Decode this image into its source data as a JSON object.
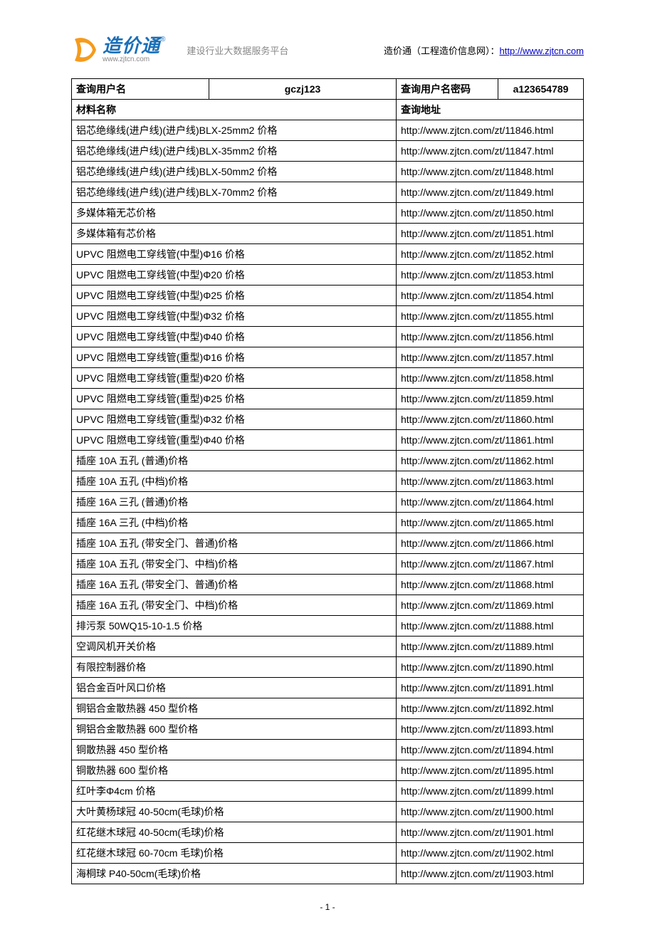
{
  "header": {
    "logo_main": "造价通",
    "logo_sub": "www.zjtcn.com",
    "tagline": "建设行业大数据服务平台",
    "right_prefix": "造价通（工程造价信息网）：",
    "right_link": "http://www.zjtcn.com"
  },
  "login_row": {
    "user_label": "查询用户名",
    "user_value": "gczj123",
    "pw_label": "查询用户名密码",
    "pw_value": "a123654789"
  },
  "table_header": {
    "name_label": "材料名称",
    "url_label": "查询地址"
  },
  "rows": [
    {
      "name": "铝芯绝缘线(进户线)(进户线)BLX-25mm2 价格",
      "url": "http://www.zjtcn.com/zt/11846.html"
    },
    {
      "name": "铝芯绝缘线(进户线)(进户线)BLX-35mm2 价格",
      "url": "http://www.zjtcn.com/zt/11847.html"
    },
    {
      "name": "铝芯绝缘线(进户线)(进户线)BLX-50mm2 价格",
      "url": "http://www.zjtcn.com/zt/11848.html"
    },
    {
      "name": "铝芯绝缘线(进户线)(进户线)BLX-70mm2 价格",
      "url": "http://www.zjtcn.com/zt/11849.html"
    },
    {
      "name": "多媒体箱无芯价格",
      "url": "http://www.zjtcn.com/zt/11850.html"
    },
    {
      "name": "多媒体箱有芯价格",
      "url": "http://www.zjtcn.com/zt/11851.html"
    },
    {
      "name": "UPVC 阻燃电工穿线管(中型)Φ16 价格",
      "url": "http://www.zjtcn.com/zt/11852.html"
    },
    {
      "name": "UPVC 阻燃电工穿线管(中型)Φ20 价格",
      "url": "http://www.zjtcn.com/zt/11853.html"
    },
    {
      "name": "UPVC 阻燃电工穿线管(中型)Φ25 价格",
      "url": "http://www.zjtcn.com/zt/11854.html"
    },
    {
      "name": "UPVC 阻燃电工穿线管(中型)Φ32 价格",
      "url": "http://www.zjtcn.com/zt/11855.html"
    },
    {
      "name": "UPVC 阻燃电工穿线管(中型)Φ40 价格",
      "url": "http://www.zjtcn.com/zt/11856.html"
    },
    {
      "name": "UPVC 阻燃电工穿线管(重型)Φ16 价格",
      "url": "http://www.zjtcn.com/zt/11857.html"
    },
    {
      "name": "UPVC 阻燃电工穿线管(重型)Φ20 价格",
      "url": "http://www.zjtcn.com/zt/11858.html"
    },
    {
      "name": "UPVC 阻燃电工穿线管(重型)Φ25 价格",
      "url": "http://www.zjtcn.com/zt/11859.html"
    },
    {
      "name": "UPVC 阻燃电工穿线管(重型)Φ32 价格",
      "url": "http://www.zjtcn.com/zt/11860.html"
    },
    {
      "name": "UPVC 阻燃电工穿线管(重型)Φ40 价格",
      "url": "http://www.zjtcn.com/zt/11861.html"
    },
    {
      "name": "插座 10A 五孔 (普通)价格",
      "url": "http://www.zjtcn.com/zt/11862.html"
    },
    {
      "name": "插座 10A 五孔 (中档)价格",
      "url": "http://www.zjtcn.com/zt/11863.html"
    },
    {
      "name": "插座 16A 三孔 (普通)价格",
      "url": "http://www.zjtcn.com/zt/11864.html"
    },
    {
      "name": "插座 16A 三孔 (中档)价格",
      "url": "http://www.zjtcn.com/zt/11865.html"
    },
    {
      "name": "插座 10A 五孔 (带安全门、普通)价格",
      "url": "http://www.zjtcn.com/zt/11866.html"
    },
    {
      "name": "插座 10A 五孔 (带安全门、中档)价格",
      "url": "http://www.zjtcn.com/zt/11867.html"
    },
    {
      "name": "插座 16A 五孔 (带安全门、普通)价格",
      "url": "http://www.zjtcn.com/zt/11868.html"
    },
    {
      "name": "插座 16A 五孔 (带安全门、中档)价格",
      "url": "http://www.zjtcn.com/zt/11869.html"
    },
    {
      "name": "排污泵 50WQ15-10-1.5 价格",
      "url": "http://www.zjtcn.com/zt/11888.html"
    },
    {
      "name": "空调风机开关价格",
      "url": "http://www.zjtcn.com/zt/11889.html"
    },
    {
      "name": "有限控制器价格",
      "url": "http://www.zjtcn.com/zt/11890.html"
    },
    {
      "name": "铝合金百叶风口价格",
      "url": "http://www.zjtcn.com/zt/11891.html"
    },
    {
      "name": "铜铝合金散热器 450 型价格",
      "url": "http://www.zjtcn.com/zt/11892.html"
    },
    {
      "name": "铜铝合金散热器 600 型价格",
      "url": "http://www.zjtcn.com/zt/11893.html"
    },
    {
      "name": "铜散热器 450 型价格",
      "url": "http://www.zjtcn.com/zt/11894.html"
    },
    {
      "name": "铜散热器 600 型价格",
      "url": "http://www.zjtcn.com/zt/11895.html"
    },
    {
      "name": "红叶李Φ4cm 价格",
      "url": "http://www.zjtcn.com/zt/11899.html"
    },
    {
      "name": "大叶黄杨球冠 40-50cm(毛球)价格",
      "url": "http://www.zjtcn.com/zt/11900.html"
    },
    {
      "name": "红花继木球冠 40-50cm(毛球)价格",
      "url": "http://www.zjtcn.com/zt/11901.html"
    },
    {
      "name": "红花继木球冠 60-70cm 毛球)价格",
      "url": "http://www.zjtcn.com/zt/11902.html"
    },
    {
      "name": "海桐球 P40-50cm(毛球)价格",
      "url": "http://www.zjtcn.com/zt/11903.html"
    }
  ],
  "footer": {
    "page_number": "- 1 -"
  }
}
